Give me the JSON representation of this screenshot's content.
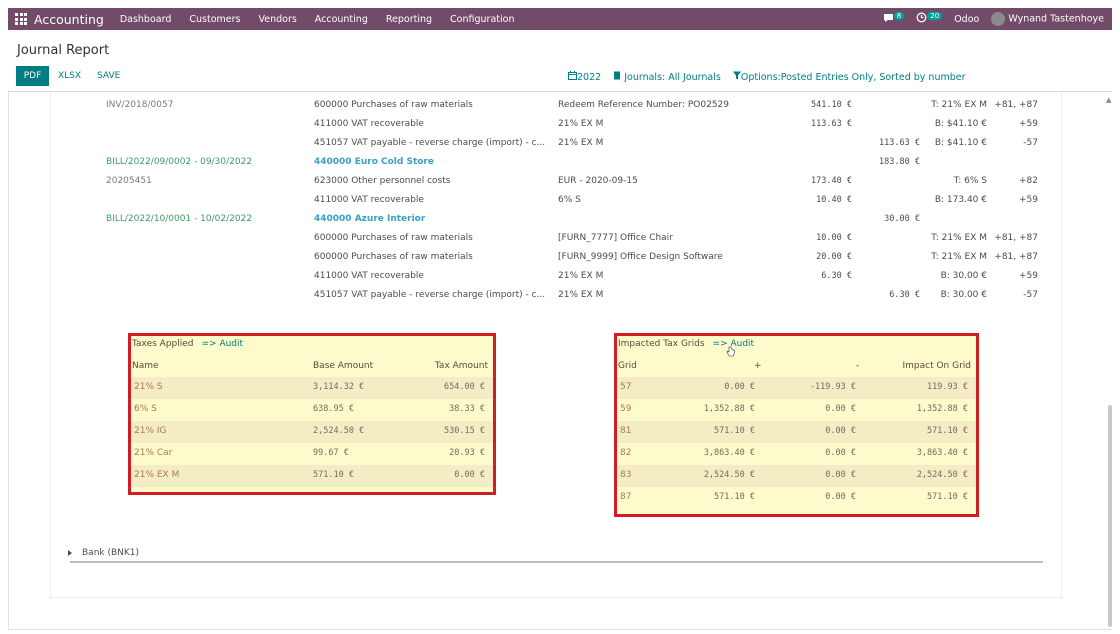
{
  "navbar": {
    "brand": "Accounting",
    "menus": [
      "Dashboard",
      "Customers",
      "Vendors",
      "Accounting",
      "Reporting",
      "Configuration"
    ],
    "messages_badge": "8",
    "activity_badge": "20",
    "company": "Odoo",
    "user": "Wynand Tastenhoye"
  },
  "page": {
    "title": "Journal Report",
    "pdf_label": "PDF",
    "xlsx_label": "XLSX",
    "save_label": "SAVE",
    "filter_date": "2022",
    "filter_journals": "Journals: All Journals",
    "filter_options": "Options:Posted Entries Only, Sorted by number"
  },
  "lines": [
    {
      "entry": "INV/2018/0057",
      "entry_link": false,
      "account": "600000 Purchases of raw materials",
      "account_link": false,
      "label": "Redeem Reference Number: PO02529",
      "debit": "541.10 €",
      "credit": "",
      "tax": "T: 21% EX M",
      "grid": "+81, +87"
    },
    {
      "entry": "",
      "entry_link": false,
      "account": "411000 VAT recoverable",
      "account_link": false,
      "label": "21% EX M",
      "debit": "113.63 €",
      "credit": "",
      "tax": "B: $41.10 €",
      "grid": "+59"
    },
    {
      "entry": "",
      "entry_link": false,
      "account": "451057 VAT payable - reverse charge (import) - c...",
      "account_link": false,
      "label": "21% EX M",
      "debit": "",
      "credit": "113.63 €",
      "tax": "B: $41.10 €",
      "grid": "-57"
    },
    {
      "entry": "BILL/2022/09/0002 - 09/30/2022",
      "entry_link": true,
      "account": "440000 Euro Cold Store",
      "account_link": true,
      "label": "",
      "debit": "",
      "credit": "183.80 €",
      "tax": "",
      "grid": ""
    },
    {
      "entry": "20205451",
      "entry_link": false,
      "account": "623000 Other personnel costs",
      "account_link": false,
      "label": "EUR - 2020-09-15",
      "debit": "173.40 €",
      "credit": "",
      "tax": "T: 6% S",
      "grid": "+82"
    },
    {
      "entry": "",
      "entry_link": false,
      "account": "411000 VAT recoverable",
      "account_link": false,
      "label": "6% S",
      "debit": "10.40 €",
      "credit": "",
      "tax": "B: 173.40 €",
      "grid": "+59"
    },
    {
      "entry": "BILL/2022/10/0001 - 10/02/2022",
      "entry_link": true,
      "account": "440000 Azure Interior",
      "account_link": true,
      "label": "",
      "debit": "",
      "credit": "30.00 €",
      "tax": "",
      "grid": ""
    },
    {
      "entry": "",
      "entry_link": false,
      "account": "600000 Purchases of raw materials",
      "account_link": false,
      "label": "[FURN_7777] Office Chair",
      "debit": "10.00 €",
      "credit": "",
      "tax": "T: 21% EX M",
      "grid": "+81, +87"
    },
    {
      "entry": "",
      "entry_link": false,
      "account": "600000 Purchases of raw materials",
      "account_link": false,
      "label": "[FURN_9999] Office Design Software",
      "debit": "20.00 €",
      "credit": "",
      "tax": "T: 21% EX M",
      "grid": "+81, +87"
    },
    {
      "entry": "",
      "entry_link": false,
      "account": "411000 VAT recoverable",
      "account_link": false,
      "label": "21% EX M",
      "debit": "6.30 €",
      "credit": "",
      "tax": "B: 30.00 €",
      "grid": "+59"
    },
    {
      "entry": "",
      "entry_link": false,
      "account": "451057 VAT payable - reverse charge (import) - c...",
      "account_link": false,
      "label": "21% EX M",
      "debit": "",
      "credit": "6.30 €",
      "tax": "B: 30.00 €",
      "grid": "-57"
    }
  ],
  "taxes_applied": {
    "title": "Taxes Applied",
    "audit": "=> Audit",
    "headers": [
      "Name",
      "Base Amount",
      "Tax Amount"
    ],
    "rows": [
      [
        "21% S",
        "3,114.32 €",
        "654.00 €"
      ],
      [
        "6% S",
        "638.95 €",
        "38.33 €"
      ],
      [
        "21% IG",
        "2,524.50 €",
        "530.15 €"
      ],
      [
        "21% Car",
        "99.67 €",
        "20.93 €"
      ],
      [
        "21% EX M",
        "571.10 €",
        "0.00 €"
      ]
    ]
  },
  "tax_grids": {
    "title": "Impacted Tax Grids",
    "audit": "=> Audit",
    "headers": [
      "Grid",
      "+",
      "-",
      "Impact On Grid"
    ],
    "rows": [
      [
        "57",
        "0.00 €",
        "-119.93 €",
        "119.93 €"
      ],
      [
        "59",
        "1,352.88 €",
        "0.00 €",
        "1,352.88 €"
      ],
      [
        "81",
        "571.10 €",
        "0.00 €",
        "571.10 €"
      ],
      [
        "82",
        "3,863.40 €",
        "0.00 €",
        "3,863.40 €"
      ],
      [
        "83",
        "2,524.50 €",
        "0.00 €",
        "2,524.50 €"
      ],
      [
        "87",
        "571.10 €",
        "0.00 €",
        "571.10 €"
      ]
    ]
  },
  "bank": {
    "label": "Bank (BNK1)"
  }
}
